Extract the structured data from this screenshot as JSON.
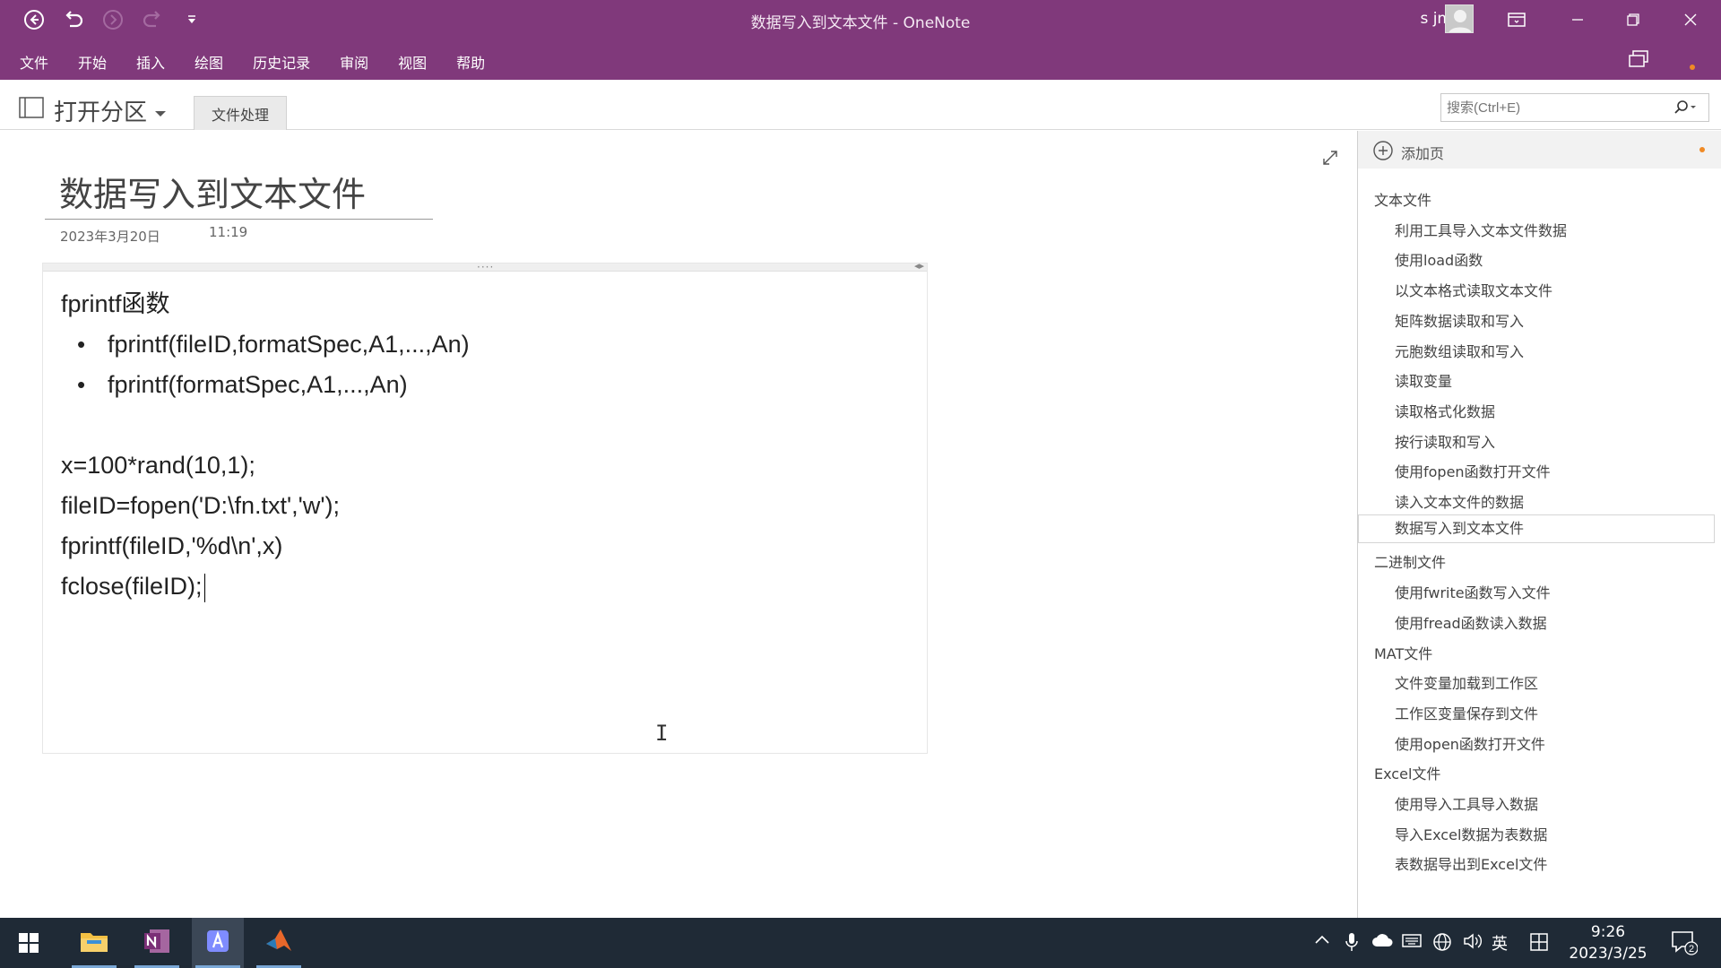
{
  "window": {
    "title": "数据写入到文本文件 - OneNote",
    "user_name": "s jm"
  },
  "menu": {
    "items": [
      "文件",
      "开始",
      "插入",
      "绘图",
      "历史记录",
      "审阅",
      "视图",
      "帮助"
    ]
  },
  "section_bar": {
    "notebook_label": "打开分区",
    "active_tab": "文件处理",
    "search_placeholder": "搜索(Ctrl+E)"
  },
  "page": {
    "title": "数据写入到文本文件",
    "date": "2023年3月20日",
    "time": "11:19",
    "heading": "fprintf函数",
    "bullets": [
      "fprintf(fileID,formatSpec,A1,...,An)",
      "fprintf(formatSpec,A1,...,An)"
    ],
    "code_lines": [
      "x=100*rand(10,1);",
      "fileID=fopen('D:\\fn.txt','w');",
      "fprintf(fileID,'%d\\n',x)",
      "fclose(fileID);"
    ]
  },
  "pagelist": {
    "add_page_label": "添加页",
    "items": [
      {
        "label": "文本文件",
        "level": "group"
      },
      {
        "label": "利用工具导入文本文件数据",
        "level": "sub"
      },
      {
        "label": "使用load函数",
        "level": "sub"
      },
      {
        "label": "以文本格式读取文本文件",
        "level": "sub"
      },
      {
        "label": "矩阵数据读取和写入",
        "level": "sub"
      },
      {
        "label": "元胞数组读取和写入",
        "level": "sub"
      },
      {
        "label": "读取变量",
        "level": "sub"
      },
      {
        "label": "读取格式化数据",
        "level": "sub"
      },
      {
        "label": "按行读取和写入",
        "level": "sub"
      },
      {
        "label": "使用fopen函数打开文件",
        "level": "sub"
      },
      {
        "label": "读入文本文件的数据",
        "level": "sub"
      },
      {
        "label": "数据写入到文本文件",
        "level": "sub",
        "selected": true
      },
      {
        "label": "二进制文件",
        "level": "group"
      },
      {
        "label": "使用fwrite函数写入文件",
        "level": "sub"
      },
      {
        "label": "使用fread函数读入数据",
        "level": "sub"
      },
      {
        "label": "MAT文件",
        "level": "group"
      },
      {
        "label": "文件变量加载到工作区",
        "level": "sub"
      },
      {
        "label": "工作区变量保存到文件",
        "level": "sub"
      },
      {
        "label": "使用open函数打开文件",
        "level": "sub"
      },
      {
        "label": "Excel文件",
        "level": "group"
      },
      {
        "label": "使用导入工具导入数据",
        "level": "sub"
      },
      {
        "label": "导入Excel数据为表数据",
        "level": "sub"
      },
      {
        "label": "表数据导出到Excel文件",
        "level": "sub"
      }
    ]
  },
  "taskbar": {
    "apps": [
      "file-explorer",
      "onenote",
      "store",
      "matlab"
    ],
    "ime_label": "英",
    "time": "9:26",
    "date": "2023/3/25",
    "notification_count": "2"
  },
  "colors": {
    "accent": "#80397b",
    "taskbar": "#1f2a36"
  }
}
